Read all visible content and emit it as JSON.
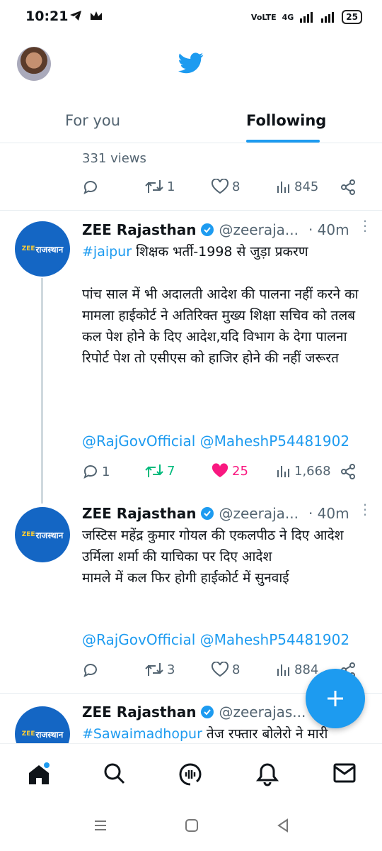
{
  "status": {
    "time": "10:21",
    "network": "4G",
    "battery": "25"
  },
  "tabs": [
    {
      "label": "For you"
    },
    {
      "label": "Following"
    }
  ],
  "prev_tweet": {
    "views": "331 views",
    "retweets": "1",
    "likes": "8",
    "view_count": "845"
  },
  "tweets": [
    {
      "name": "ZEE Rajasthan",
      "handle": "@zeeraja...",
      "time": "· 40m",
      "avatar_text": "राजस्थान",
      "hashtag": "#jaipur",
      "text": " शिक्षक भर्ती-1998 से जुड़ा प्रकरण\n\nपांच साल में भी अदालती आदेश की पालना नहीं करने का मामला हाईकोर्ट ने अतिरिक्त मुख्य शिक्षा सचिव को तलब\nकल पेश होने के दिए आदेश,यदि विभाग के देगा पालना रिपोर्ट पेश तो एसीएस को हाजिर होने की नहीं जरूरत",
      "mentions": "@RajGovOfficial @MaheshP54481902",
      "replies": "1",
      "retweets": "7",
      "likes": "25",
      "views": "1,668"
    },
    {
      "name": "ZEE Rajasthan",
      "handle": "@zeeraja...",
      "time": "· 40m",
      "avatar_text": "राजस्थान",
      "text": "जस्टिस महेंद्र कुमार गोयल की एकलपीठ ने दिए आदेश\nउर्मिला शर्मा की याचिका पर दिए आदेश\nमामले में कल फिर होगी हाईकोर्ट में सुनवाई",
      "mentions": "@RajGovOfficial @MaheshP54481902",
      "retweets": "3",
      "likes": "8",
      "views": "884"
    },
    {
      "name": "ZEE Rajasthan",
      "handle": "@zeerajas...",
      "time": "·",
      "avatar_text": "राजस्थान",
      "hashtag": "#Sawaimadhopur",
      "text": " तेज रफ्तार बोलेरो ने मारी"
    }
  ],
  "colors": {
    "accent": "#1d9bf0",
    "retweet": "#00ba7c",
    "like": "#f91880"
  }
}
